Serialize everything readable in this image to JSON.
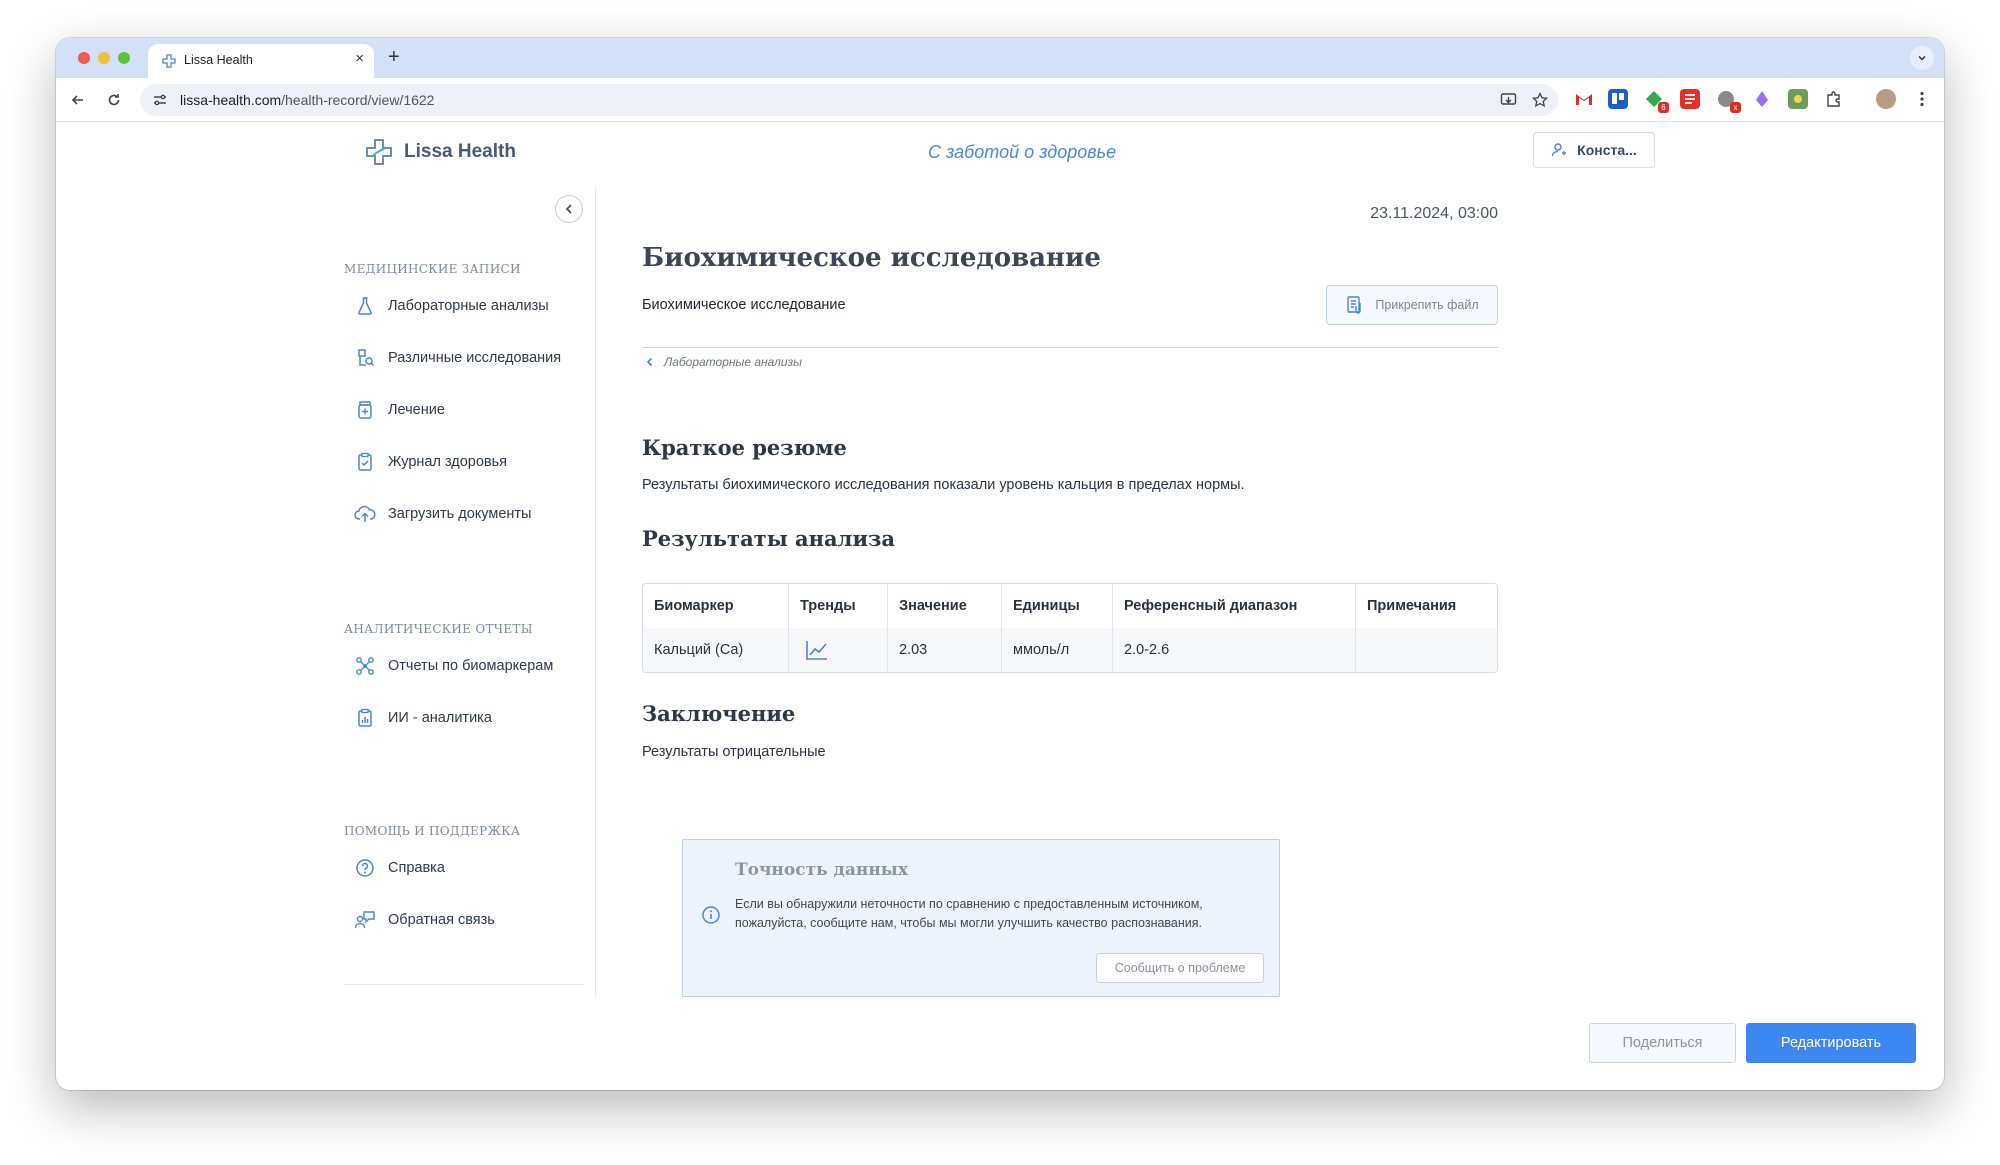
{
  "browser": {
    "tab_title": "Lissa Health",
    "new_tab": "+",
    "close": "×",
    "url_host": "lissa-health.com",
    "url_path": "/health-record/view/1622",
    "extensions": [
      {
        "name": "gmail-icon",
        "color": "#d93025"
      },
      {
        "name": "trello-icon",
        "color": "#1f5fbf"
      },
      {
        "name": "green-ext-icon",
        "color": "#34a853",
        "badge": "6"
      },
      {
        "name": "red-doc-icon",
        "color": "#e0312b"
      },
      {
        "name": "grey-ext-icon",
        "color": "#8a8a8a",
        "badge": "x"
      },
      {
        "name": "purple-ext-icon",
        "color": "#9b6df0"
      },
      {
        "name": "photo-ext-icon",
        "color": "#6b9e5b"
      }
    ]
  },
  "header": {
    "logo_text": "Lissa Health",
    "tagline": "С заботой о здоровье",
    "user_label": "Конста..."
  },
  "sidebar": {
    "sections": [
      {
        "title": "МЕДИЦИНСКИЕ ЗАПИСИ",
        "items": [
          {
            "label": "Лабораторные анализы",
            "icon": "flask-icon"
          },
          {
            "label": "Различные исследования",
            "icon": "research-icon"
          },
          {
            "label": "Лечение",
            "icon": "medicine-icon"
          },
          {
            "label": "Журнал здоровья",
            "icon": "clipboard-check-icon"
          },
          {
            "label": "Загрузить документы",
            "icon": "cloud-upload-icon"
          }
        ]
      },
      {
        "title": "АНАЛИТИЧЕСКИЕ ОТЧЕТЫ",
        "items": [
          {
            "label": "Отчеты по биомаркерам",
            "icon": "network-icon"
          },
          {
            "label": "ИИ - аналитика",
            "icon": "report-icon"
          }
        ]
      },
      {
        "title": "ПОМОЩЬ И ПОДДЕРЖКА",
        "items": [
          {
            "label": "Справка",
            "icon": "help-icon"
          },
          {
            "label": "Обратная связь",
            "icon": "feedback-icon"
          }
        ]
      }
    ]
  },
  "record": {
    "date": "23.11.2024, 03:00",
    "title": "Биохимическое исследование",
    "subtitle": "Биохимическое исследование",
    "attach_label": "Прикрепить файл",
    "breadcrumb": "Лабораторные анализы",
    "summary_heading": "Краткое резюме",
    "summary_text": "Результаты биохимического исследования показали уровень кальция в пределах нормы.",
    "results_heading": "Результаты анализа",
    "table": {
      "headers": [
        "Биомаркер",
        "Тренды",
        "Значение",
        "Единицы",
        "Референсный диапазон",
        "Примечания"
      ],
      "rows": [
        {
          "biomarker": "Кальций (Ca)",
          "trend_icon": "trend-chart-icon",
          "value": "2.03",
          "units": "ммоль/л",
          "range": "2.0-2.6",
          "notes": ""
        }
      ]
    },
    "conclusion_heading": "Заключение",
    "conclusion_text": "Результаты отрицательные"
  },
  "accuracy": {
    "title": "Точность данных",
    "text": "Если вы обнаружили неточности по сравнению с предоставленным источником, пожалуйста, сообщите нам, чтобы мы могли улучшить качество распознавания.",
    "button": "Сообщить о проблеме"
  },
  "footer": {
    "share_label": "Поделиться",
    "edit_label": "Редактировать"
  },
  "colors": {
    "accent": "#3f87f0",
    "tagline": "#4a86d8",
    "tabbar": "#d4e0f8"
  }
}
